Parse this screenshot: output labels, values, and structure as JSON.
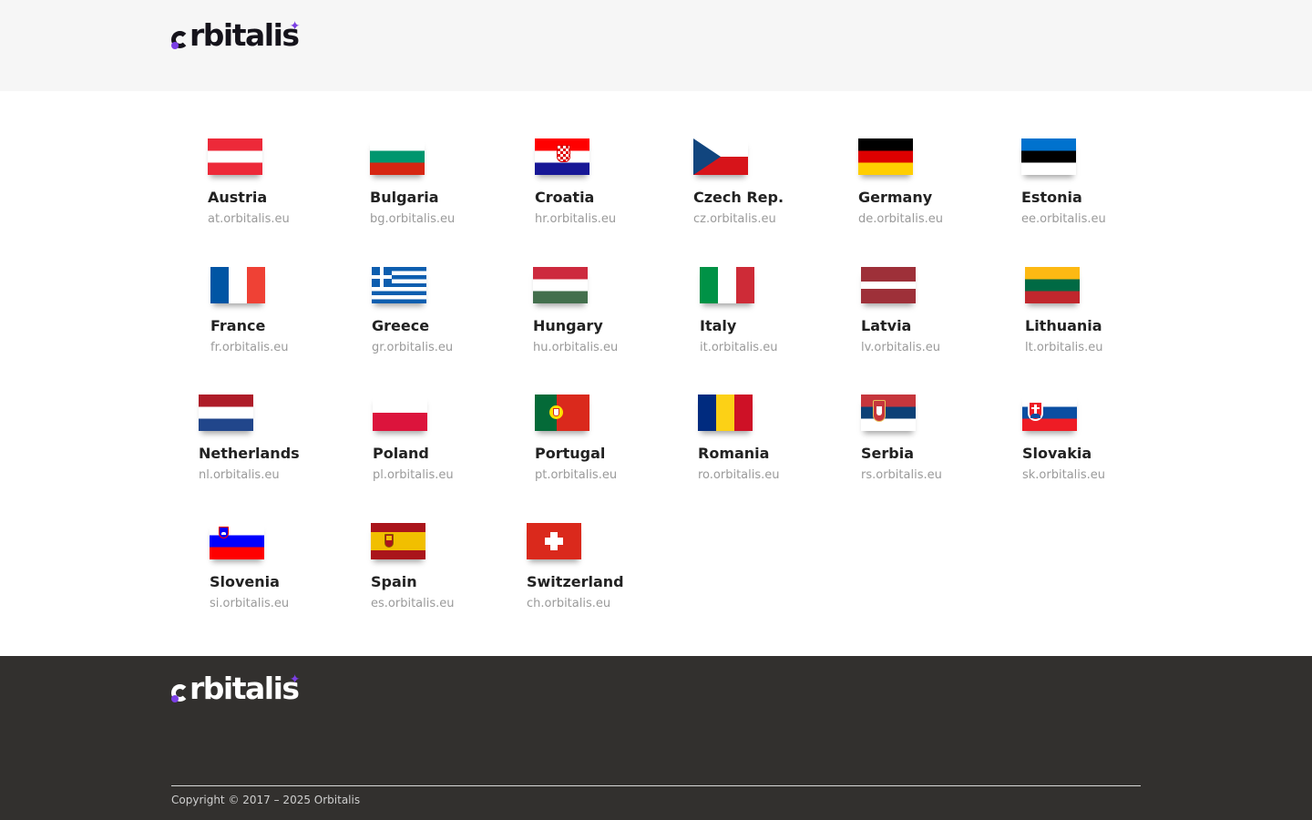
{
  "header": {
    "logo_text": "orbitalis"
  },
  "countries": [
    {
      "name": "Austria",
      "domain": "at.orbitalis.eu"
    },
    {
      "name": "Bulgaria",
      "domain": "bg.orbitalis.eu"
    },
    {
      "name": "Croatia",
      "domain": "hr.orbitalis.eu"
    },
    {
      "name": "Czech Rep.",
      "domain": "cz.orbitalis.eu"
    },
    {
      "name": "Germany",
      "domain": "de.orbitalis.eu"
    },
    {
      "name": "Estonia",
      "domain": "ee.orbitalis.eu"
    },
    {
      "name": "France",
      "domain": "fr.orbitalis.eu"
    },
    {
      "name": "Greece",
      "domain": "gr.orbitalis.eu"
    },
    {
      "name": "Hungary",
      "domain": "hu.orbitalis.eu"
    },
    {
      "name": "Italy",
      "domain": "it.orbitalis.eu"
    },
    {
      "name": "Latvia",
      "domain": "lv.orbitalis.eu"
    },
    {
      "name": "Lithuania",
      "domain": "lt.orbitalis.eu"
    },
    {
      "name": "Netherlands",
      "domain": "nl.orbitalis.eu"
    },
    {
      "name": "Poland",
      "domain": "pl.orbitalis.eu"
    },
    {
      "name": "Portugal",
      "domain": "pt.orbitalis.eu"
    },
    {
      "name": "Romania",
      "domain": "ro.orbitalis.eu"
    },
    {
      "name": "Serbia",
      "domain": "rs.orbitalis.eu"
    },
    {
      "name": "Slovakia",
      "domain": "sk.orbitalis.eu"
    },
    {
      "name": "Slovenia",
      "domain": "si.orbitalis.eu"
    },
    {
      "name": "Spain",
      "domain": "es.orbitalis.eu"
    },
    {
      "name": "Switzerland",
      "domain": "ch.orbitalis.eu"
    }
  ],
  "footer": {
    "logo_text": "orbitalis",
    "copyright": "Copyright © 2017 – 2025 Orbitalis"
  },
  "colors": {
    "brand_accent": "#7b3fe4",
    "footer_bg": "#32302e",
    "header_bg": "#f6f6f6"
  }
}
